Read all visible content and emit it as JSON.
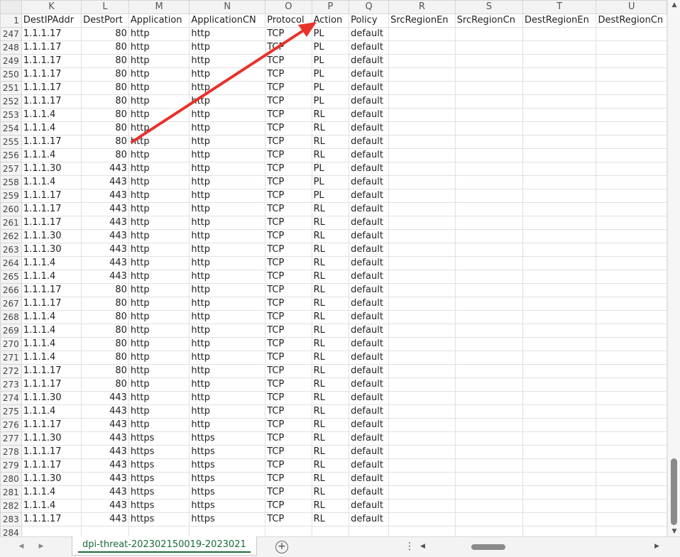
{
  "columns": [
    {
      "letter": "K",
      "header": "DestIPAddr"
    },
    {
      "letter": "L",
      "header": "DestPort"
    },
    {
      "letter": "M",
      "header": "Application"
    },
    {
      "letter": "N",
      "header": "ApplicationCN"
    },
    {
      "letter": "O",
      "header": "Protocol"
    },
    {
      "letter": "P",
      "header": "Action"
    },
    {
      "letter": "Q",
      "header": "Policy"
    },
    {
      "letter": "R",
      "header": "SrcRegionEn"
    },
    {
      "letter": "S",
      "header": "SrcRegionCn"
    },
    {
      "letter": "T",
      "header": "DestRegionEn"
    },
    {
      "letter": "U",
      "header": "DestRegionCn"
    }
  ],
  "header_row_number": "1",
  "rows": [
    {
      "n": "247",
      "ip": "1.1.1.17",
      "port": "80",
      "app": "http",
      "appcn": "http",
      "proto": "TCP",
      "action": "PL",
      "policy": "default"
    },
    {
      "n": "248",
      "ip": "1.1.1.17",
      "port": "80",
      "app": "http",
      "appcn": "http",
      "proto": "TCP",
      "action": "PL",
      "policy": "default"
    },
    {
      "n": "249",
      "ip": "1.1.1.17",
      "port": "80",
      "app": "http",
      "appcn": "http",
      "proto": "TCP",
      "action": "PL",
      "policy": "default"
    },
    {
      "n": "250",
      "ip": "1.1.1.17",
      "port": "80",
      "app": "http",
      "appcn": "http",
      "proto": "TCP",
      "action": "PL",
      "policy": "default"
    },
    {
      "n": "251",
      "ip": "1.1.1.17",
      "port": "80",
      "app": "http",
      "appcn": "http",
      "proto": "TCP",
      "action": "PL",
      "policy": "default"
    },
    {
      "n": "252",
      "ip": "1.1.1.17",
      "port": "80",
      "app": "http",
      "appcn": "http",
      "proto": "TCP",
      "action": "PL",
      "policy": "default"
    },
    {
      "n": "253",
      "ip": "1.1.1.4",
      "port": "80",
      "app": "http",
      "appcn": "http",
      "proto": "TCP",
      "action": "RL",
      "policy": "default"
    },
    {
      "n": "254",
      "ip": "1.1.1.4",
      "port": "80",
      "app": "http",
      "appcn": "http",
      "proto": "TCP",
      "action": "RL",
      "policy": "default"
    },
    {
      "n": "255",
      "ip": "1.1.1.17",
      "port": "80",
      "app": "http",
      "appcn": "http",
      "proto": "TCP",
      "action": "RL",
      "policy": "default"
    },
    {
      "n": "256",
      "ip": "1.1.1.4",
      "port": "80",
      "app": "http",
      "appcn": "http",
      "proto": "TCP",
      "action": "RL",
      "policy": "default"
    },
    {
      "n": "257",
      "ip": "1.1.1.30",
      "port": "443",
      "app": "http",
      "appcn": "http",
      "proto": "TCP",
      "action": "PL",
      "policy": "default"
    },
    {
      "n": "258",
      "ip": "1.1.1.4",
      "port": "443",
      "app": "http",
      "appcn": "http",
      "proto": "TCP",
      "action": "PL",
      "policy": "default"
    },
    {
      "n": "259",
      "ip": "1.1.1.17",
      "port": "443",
      "app": "http",
      "appcn": "http",
      "proto": "TCP",
      "action": "PL",
      "policy": "default"
    },
    {
      "n": "260",
      "ip": "1.1.1.17",
      "port": "443",
      "app": "http",
      "appcn": "http",
      "proto": "TCP",
      "action": "RL",
      "policy": "default"
    },
    {
      "n": "261",
      "ip": "1.1.1.17",
      "port": "443",
      "app": "http",
      "appcn": "http",
      "proto": "TCP",
      "action": "RL",
      "policy": "default"
    },
    {
      "n": "262",
      "ip": "1.1.1.30",
      "port": "443",
      "app": "http",
      "appcn": "http",
      "proto": "TCP",
      "action": "RL",
      "policy": "default"
    },
    {
      "n": "263",
      "ip": "1.1.1.30",
      "port": "443",
      "app": "http",
      "appcn": "http",
      "proto": "TCP",
      "action": "RL",
      "policy": "default"
    },
    {
      "n": "264",
      "ip": "1.1.1.4",
      "port": "443",
      "app": "http",
      "appcn": "http",
      "proto": "TCP",
      "action": "RL",
      "policy": "default"
    },
    {
      "n": "265",
      "ip": "1.1.1.4",
      "port": "443",
      "app": "http",
      "appcn": "http",
      "proto": "TCP",
      "action": "RL",
      "policy": "default"
    },
    {
      "n": "266",
      "ip": "1.1.1.17",
      "port": "80",
      "app": "http",
      "appcn": "http",
      "proto": "TCP",
      "action": "RL",
      "policy": "default"
    },
    {
      "n": "267",
      "ip": "1.1.1.17",
      "port": "80",
      "app": "http",
      "appcn": "http",
      "proto": "TCP",
      "action": "RL",
      "policy": "default"
    },
    {
      "n": "268",
      "ip": "1.1.1.4",
      "port": "80",
      "app": "http",
      "appcn": "http",
      "proto": "TCP",
      "action": "RL",
      "policy": "default"
    },
    {
      "n": "269",
      "ip": "1.1.1.4",
      "port": "80",
      "app": "http",
      "appcn": "http",
      "proto": "TCP",
      "action": "RL",
      "policy": "default"
    },
    {
      "n": "270",
      "ip": "1.1.1.4",
      "port": "80",
      "app": "http",
      "appcn": "http",
      "proto": "TCP",
      "action": "RL",
      "policy": "default"
    },
    {
      "n": "271",
      "ip": "1.1.1.4",
      "port": "80",
      "app": "http",
      "appcn": "http",
      "proto": "TCP",
      "action": "RL",
      "policy": "default"
    },
    {
      "n": "272",
      "ip": "1.1.1.17",
      "port": "80",
      "app": "http",
      "appcn": "http",
      "proto": "TCP",
      "action": "RL",
      "policy": "default"
    },
    {
      "n": "273",
      "ip": "1.1.1.17",
      "port": "80",
      "app": "http",
      "appcn": "http",
      "proto": "TCP",
      "action": "RL",
      "policy": "default"
    },
    {
      "n": "274",
      "ip": "1.1.1.30",
      "port": "443",
      "app": "http",
      "appcn": "http",
      "proto": "TCP",
      "action": "RL",
      "policy": "default"
    },
    {
      "n": "275",
      "ip": "1.1.1.4",
      "port": "443",
      "app": "http",
      "appcn": "http",
      "proto": "TCP",
      "action": "RL",
      "policy": "default"
    },
    {
      "n": "276",
      "ip": "1.1.1.17",
      "port": "443",
      "app": "http",
      "appcn": "http",
      "proto": "TCP",
      "action": "RL",
      "policy": "default"
    },
    {
      "n": "277",
      "ip": "1.1.1.30",
      "port": "443",
      "app": "https",
      "appcn": "https",
      "proto": "TCP",
      "action": "RL",
      "policy": "default"
    },
    {
      "n": "278",
      "ip": "1.1.1.17",
      "port": "443",
      "app": "https",
      "appcn": "https",
      "proto": "TCP",
      "action": "RL",
      "policy": "default"
    },
    {
      "n": "279",
      "ip": "1.1.1.17",
      "port": "443",
      "app": "https",
      "appcn": "https",
      "proto": "TCP",
      "action": "RL",
      "policy": "default"
    },
    {
      "n": "280",
      "ip": "1.1.1.30",
      "port": "443",
      "app": "https",
      "appcn": "https",
      "proto": "TCP",
      "action": "RL",
      "policy": "default"
    },
    {
      "n": "281",
      "ip": "1.1.1.4",
      "port": "443",
      "app": "https",
      "appcn": "https",
      "proto": "TCP",
      "action": "RL",
      "policy": "default"
    },
    {
      "n": "282",
      "ip": "1.1.1.4",
      "port": "443",
      "app": "https",
      "appcn": "https",
      "proto": "TCP",
      "action": "RL",
      "policy": "default"
    },
    {
      "n": "283",
      "ip": "1.1.1.17",
      "port": "443",
      "app": "https",
      "appcn": "https",
      "proto": "TCP",
      "action": "RL",
      "policy": "default"
    },
    {
      "n": "284",
      "ip": "",
      "port": "",
      "app": "",
      "appcn": "",
      "proto": "",
      "action": "",
      "policy": ""
    }
  ],
  "sheet_tab": {
    "label": "dpi-threat-202302150019-2023021"
  },
  "icons": {
    "prev_sheet": "triangle-left-icon",
    "next_sheet": "triangle-right-icon",
    "add_sheet": "plus-circle-icon",
    "more": "vertical-ellipsis-icon"
  },
  "annotation": {
    "type": "arrow",
    "color": "#e8312a"
  },
  "colors": {
    "tab_accent": "#1b6b37",
    "grid_line": "#e1e1e1",
    "header_bg": "#f3f3f3"
  }
}
